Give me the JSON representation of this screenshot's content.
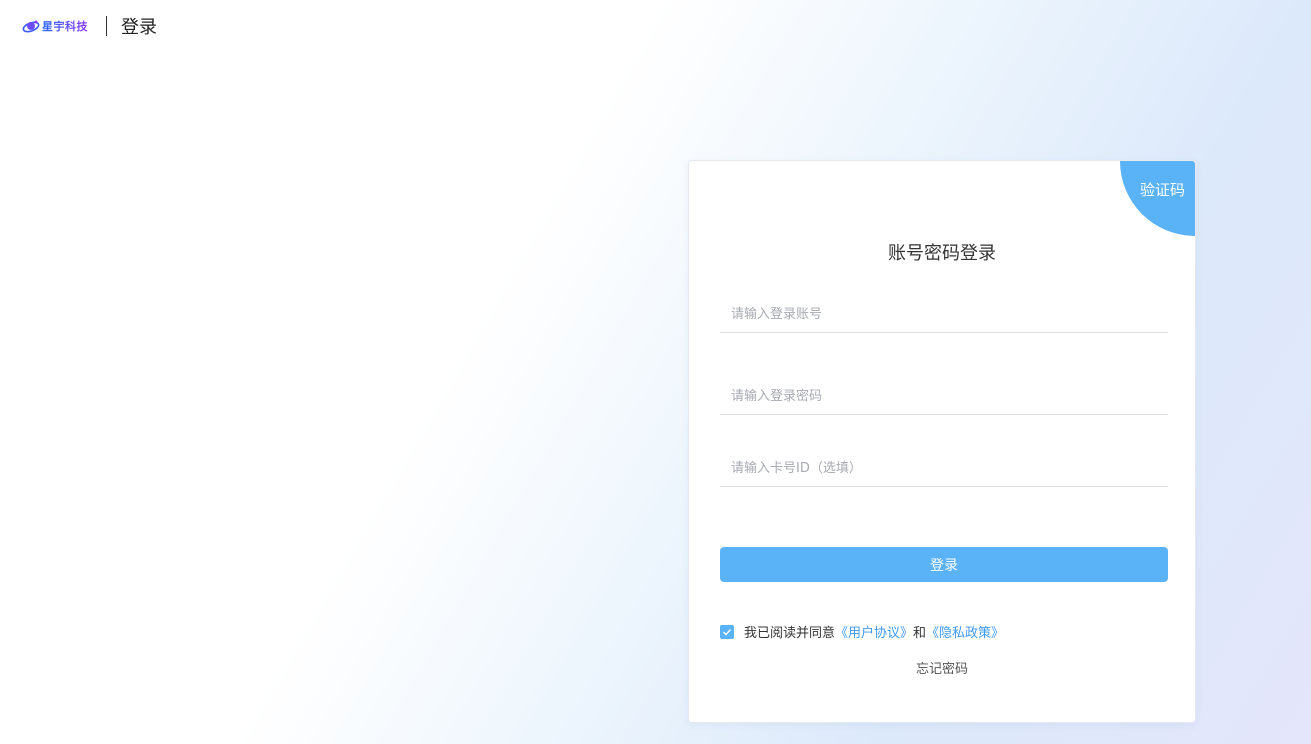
{
  "header": {
    "brand": "星宇科技",
    "title": "登录"
  },
  "card": {
    "corner_tab": "验证码",
    "title": "账号密码登录",
    "account_placeholder": "请输入登录账号",
    "password_placeholder": "请输入登录密码",
    "card_id_placeholder": "请输入卡号ID（选填）",
    "login_button": "登录",
    "agree_prefix": "我已阅读并同意",
    "user_agreement": "《用户协议》",
    "agree_and": "和",
    "privacy_policy": "《隐私政策》",
    "forgot_password": "忘记密码",
    "agree_checked": true
  },
  "colors": {
    "accent": "#5ab2f7",
    "link": "#3f9af2"
  }
}
